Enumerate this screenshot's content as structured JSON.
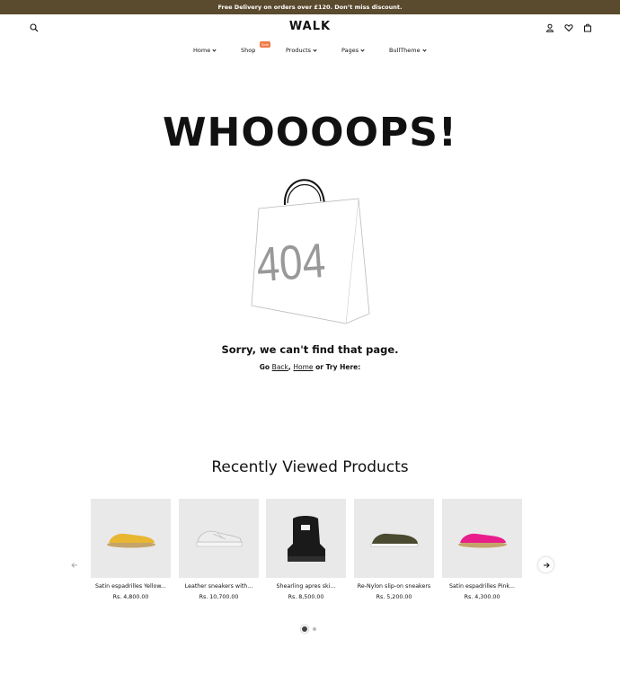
{
  "announcement": "Free Delivery on orders over £120. Don’t miss discount.",
  "header": {
    "logo": "WALK",
    "icons": [
      "search-icon",
      "user-icon",
      "heart-icon",
      "bag-icon"
    ]
  },
  "nav": {
    "items": [
      {
        "label": "Home"
      },
      {
        "label": "Shop",
        "badge": "Sale"
      },
      {
        "label": "Products"
      },
      {
        "label": "Pages"
      },
      {
        "label": "BullTheme"
      }
    ]
  },
  "error": {
    "heading": "WHOOOOPS!",
    "code": "404",
    "message": "Sorry, we can't find that page.",
    "go_prefix": "Go",
    "back_link": "Back",
    "sep": ",",
    "home_link": "Home",
    "try_suffix": "or Try Here:"
  },
  "recent": {
    "title": "Recently Viewed Products",
    "products": [
      {
        "name": "Satin espadrilles Yellow...",
        "price": "Rs. 4,800.00",
        "color": "#e9b632"
      },
      {
        "name": "Leather sneakers with...",
        "price": "Rs. 10,700.00",
        "color": "#e6e6e6"
      },
      {
        "name": "Shearling apres ski...",
        "price": "Rs. 8,500.00",
        "color": "#1a1a1a"
      },
      {
        "name": "Re-Nylon slip-on sneakers",
        "price": "Rs. 5,200.00",
        "color": "#4a4a30"
      },
      {
        "name": "Satin espadrilles Pink...",
        "price": "Rs. 4,300.00",
        "color": "#e91e8c"
      }
    ]
  },
  "colors": {
    "announce_bg": "#5a4a2e",
    "badge": "#f07a45"
  }
}
